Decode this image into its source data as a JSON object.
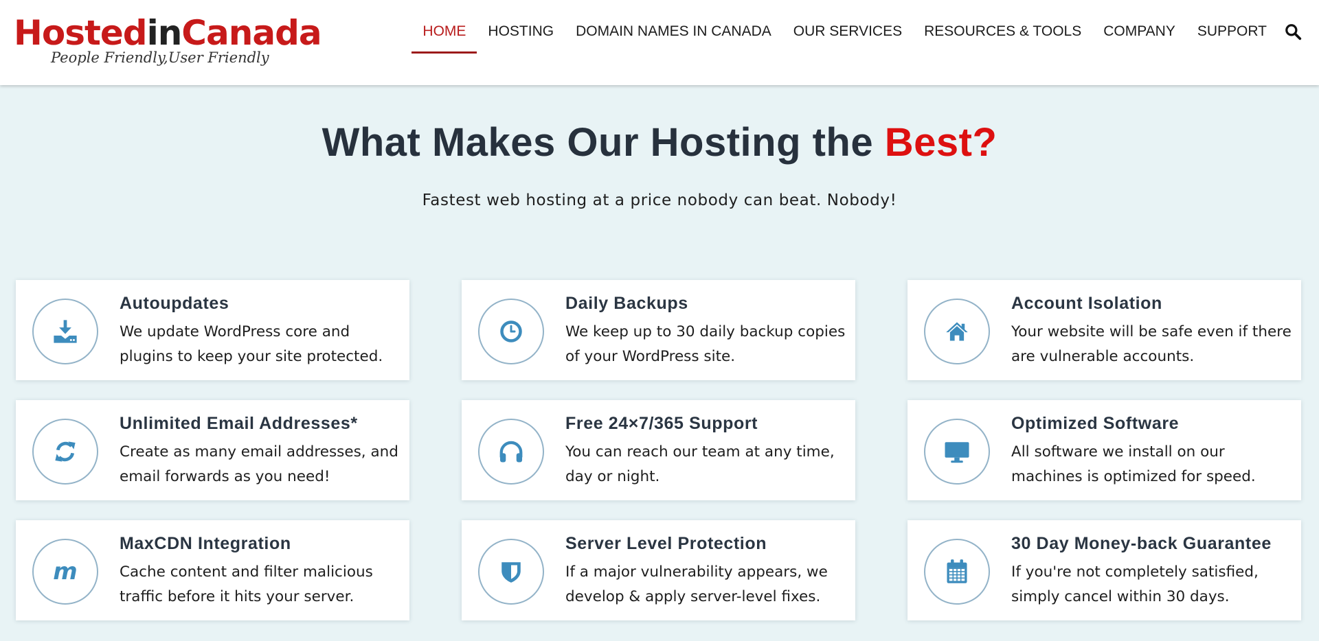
{
  "header": {
    "logo": {
      "part1": "Hosted",
      "part2": "in",
      "part3": "Canada",
      "tagline": "People Friendly,User Friendly"
    },
    "nav": [
      {
        "label": "HOME",
        "active": true
      },
      {
        "label": "HOSTING",
        "active": false
      },
      {
        "label": "DOMAIN NAMES IN CANADA",
        "active": false
      },
      {
        "label": "OUR SERVICES",
        "active": false
      },
      {
        "label": "RESOURCES & TOOLS",
        "active": false
      },
      {
        "label": "COMPANY",
        "active": false
      },
      {
        "label": "SUPPORT",
        "active": false
      }
    ],
    "search_icon": "search-icon"
  },
  "hero": {
    "title_main": "What Makes Our Hosting the ",
    "title_accent": "Best?",
    "subtitle": "Fastest web hosting at a price nobody can beat. Nobody!"
  },
  "features": [
    {
      "title": "Autoupdates",
      "desc": "We update WordPress core and plugins to keep your site protected.",
      "icon": "download-icon"
    },
    {
      "title": "Daily Backups",
      "desc": "We keep up to 30 daily backup copies of your WordPress site.",
      "icon": "clock-icon"
    },
    {
      "title": "Account Isolation",
      "desc": "Your website will be safe even if there are vulnerable accounts.",
      "icon": "home-icon"
    },
    {
      "title": "Unlimited Email Addresses*",
      "desc": "Create as many email addresses, and email forwards as you need!",
      "icon": "refresh-icon"
    },
    {
      "title": "Free 24×7/365 Support",
      "desc": "You can reach our team at any time, day or night.",
      "icon": "headphones-icon"
    },
    {
      "title": "Optimized Software",
      "desc": "All software we install on our machines is optimized for speed.",
      "icon": "monitor-icon"
    },
    {
      "title": "MaxCDN Integration",
      "desc": "Cache content and filter malicious traffic before it hits your server.",
      "icon": "maxcdn-icon"
    },
    {
      "title": "Server Level Protection",
      "desc": "If a major vulnerability appears, we develop & apply server-level fixes.",
      "icon": "shield-icon"
    },
    {
      "title": "30 Day Money-back Guarantee",
      "desc": "If you're not completely satisfied, simply cancel within 30 days.",
      "icon": "calendar-icon"
    }
  ],
  "colors": {
    "brand_red": "#c71a1a",
    "accent_red": "#dd1010",
    "icon_blue": "#3d8cbd",
    "icon_ring": "#93b3c8",
    "background": "#e8f3f5"
  }
}
